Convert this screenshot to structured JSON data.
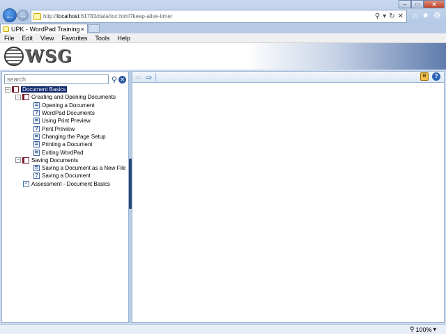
{
  "browser": {
    "url_prefix": "http://",
    "url_host": "localhost",
    "url_rest": ":61783/data/toc.html?keep-alive-timer",
    "tab_title": "UPK - WordPad Training",
    "tab_close": "×",
    "menu": [
      "File",
      "Edit",
      "View",
      "Favorites",
      "Tools",
      "Help"
    ],
    "zoom": "100%"
  },
  "banner": {
    "logo_text": "WSG"
  },
  "search": {
    "placeholder": "search"
  },
  "toc": {
    "root": "Document Basics",
    "section1": {
      "title": "Creating and Opening Documents",
      "items": [
        "Opening a Document",
        "WordPad Documents",
        "Using Print Preview",
        "Print Preview",
        "Changing the Page Setup",
        "Printing a Document",
        "Exiting WordPad"
      ]
    },
    "section2": {
      "title": "Saving Documents",
      "items": [
        "Saving a Document as a New File",
        "Saving a Document"
      ]
    },
    "assessment": "Assessment - Document Basics"
  },
  "colors": {
    "selection": "#0a246a",
    "accent": "#2a62b8"
  }
}
